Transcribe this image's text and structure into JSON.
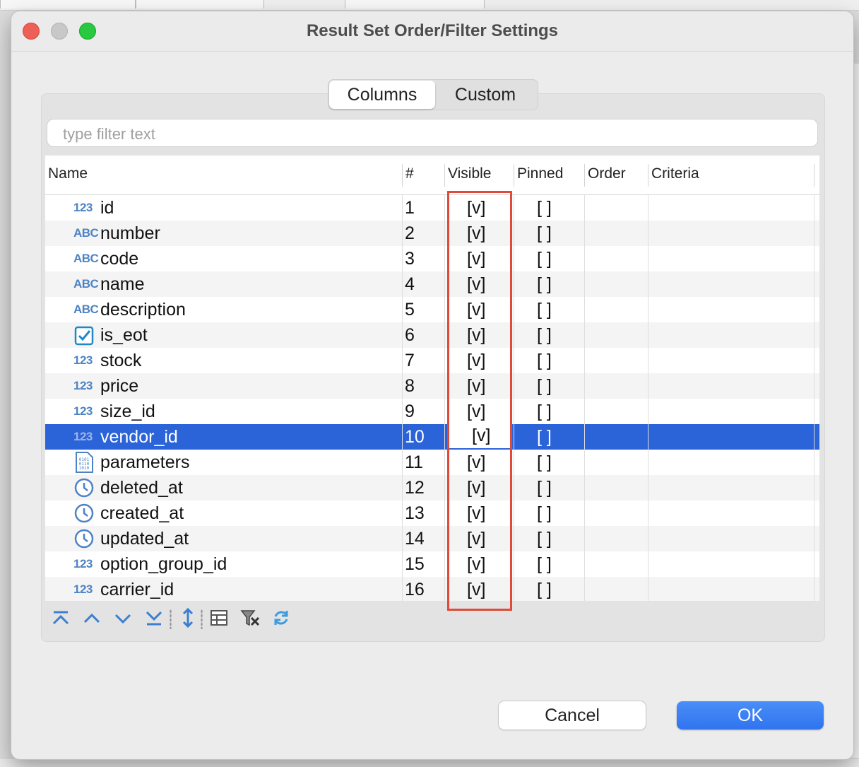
{
  "window": {
    "title": "Result Set Order/Filter Settings"
  },
  "tabs": [
    {
      "label": "Columns",
      "active": true
    },
    {
      "label": "Custom",
      "active": false
    }
  ],
  "filter": {
    "placeholder": "type filter text",
    "value": ""
  },
  "table": {
    "headers": {
      "name": "Name",
      "num": "#",
      "visible": "Visible",
      "pinned": "Pinned",
      "order": "Order",
      "criteria": "Criteria"
    },
    "rows": [
      {
        "icon": "numeric-type-icon",
        "icon_text": "123",
        "name": "id",
        "num": "1",
        "visible": "[v]",
        "pinned": "[ ]"
      },
      {
        "icon": "string-type-icon",
        "icon_text": "ABC",
        "name": "number",
        "num": "2",
        "visible": "[v]",
        "pinned": "[ ]"
      },
      {
        "icon": "string-type-icon",
        "icon_text": "ABC",
        "name": "code",
        "num": "3",
        "visible": "[v]",
        "pinned": "[ ]"
      },
      {
        "icon": "string-type-icon",
        "icon_text": "ABC",
        "name": "name",
        "num": "4",
        "visible": "[v]",
        "pinned": "[ ]"
      },
      {
        "icon": "string-type-icon",
        "icon_text": "ABC",
        "name": "description",
        "num": "5",
        "visible": "[v]",
        "pinned": "[ ]"
      },
      {
        "icon": "boolean-type-icon",
        "icon_text": "",
        "name": "is_eot",
        "num": "6",
        "visible": "[v]",
        "pinned": "[ ]"
      },
      {
        "icon": "numeric-type-icon",
        "icon_text": "123",
        "name": "stock",
        "num": "7",
        "visible": "[v]",
        "pinned": "[ ]"
      },
      {
        "icon": "numeric-type-icon",
        "icon_text": "123",
        "name": "price",
        "num": "8",
        "visible": "[v]",
        "pinned": "[ ]"
      },
      {
        "icon": "numeric-type-icon",
        "icon_text": "123",
        "name": "size_id",
        "num": "9",
        "visible": "[v]",
        "pinned": "[ ]"
      },
      {
        "icon": "numeric-type-icon",
        "icon_text": "123",
        "name": "vendor_id",
        "num": "10",
        "visible": "[v]",
        "pinned": "[ ]",
        "selected": true
      },
      {
        "icon": "binary-type-icon",
        "icon_text": "",
        "name": "parameters",
        "num": "11",
        "visible": "[v]",
        "pinned": "[ ]"
      },
      {
        "icon": "datetime-type-icon",
        "icon_text": "",
        "name": "deleted_at",
        "num": "12",
        "visible": "[v]",
        "pinned": "[ ]"
      },
      {
        "icon": "datetime-type-icon",
        "icon_text": "",
        "name": "created_at",
        "num": "13",
        "visible": "[v]",
        "pinned": "[ ]"
      },
      {
        "icon": "datetime-type-icon",
        "icon_text": "",
        "name": "updated_at",
        "num": "14",
        "visible": "[v]",
        "pinned": "[ ]"
      },
      {
        "icon": "numeric-type-icon",
        "icon_text": "123",
        "name": "option_group_id",
        "num": "15",
        "visible": "[v]",
        "pinned": "[ ]"
      },
      {
        "icon": "numeric-type-icon",
        "icon_text": "123",
        "name": "carrier_id",
        "num": "16",
        "visible": "[v]",
        "pinned": "[ ]"
      }
    ]
  },
  "toolbar": [
    "move-to-top-icon",
    "move-up-icon",
    "move-down-icon",
    "move-to-bottom-icon",
    "sort-icon",
    "table-config-icon",
    "reset-filter-icon",
    "refresh-icon"
  ],
  "buttons": {
    "cancel": "Cancel",
    "ok": "OK"
  },
  "colors": {
    "selection": "#2b63d9",
    "highlight_box": "#e04a3a",
    "ok_button": "#2f74ee",
    "type_icon": "#4d83c4"
  }
}
